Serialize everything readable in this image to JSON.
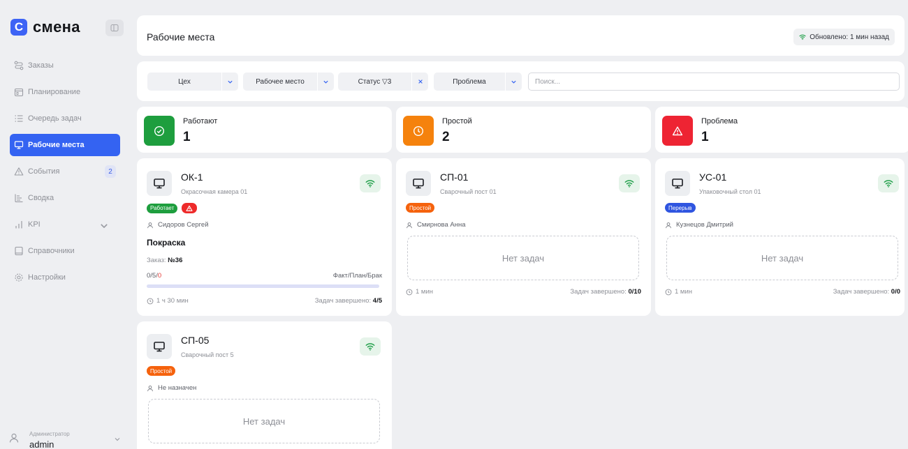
{
  "app": {
    "logo_letter": "C",
    "logo_text": "смена"
  },
  "sidebar": {
    "items": [
      {
        "label": "Заказы",
        "icon": "route-icon"
      },
      {
        "label": "Планирование",
        "icon": "calendar-icon"
      },
      {
        "label": "Очередь задач",
        "icon": "list-icon"
      },
      {
        "label": "Рабочие места",
        "icon": "monitor-icon",
        "active": true
      },
      {
        "label": "События",
        "icon": "warning-icon",
        "badge": "2"
      },
      {
        "label": "Сводка",
        "icon": "chart-icon"
      },
      {
        "label": "KPI",
        "icon": "bars-icon"
      },
      {
        "label": "Справочники",
        "icon": "book-icon"
      },
      {
        "label": "Настройки",
        "icon": "gear-icon"
      }
    ],
    "user": {
      "role": "Администратор",
      "name": "admin"
    }
  },
  "header": {
    "title": "Рабочие места",
    "updated": "Обновлено: 1 мин назад"
  },
  "filters": {
    "shop": "Цех",
    "workplace": "Рабочее место",
    "status": "Статус ▽3",
    "problem": "Проблема",
    "search_placeholder": "Поиск..."
  },
  "stats": [
    {
      "label": "Работают",
      "value": "1",
      "color": "#1e9e3e"
    },
    {
      "label": "Простой",
      "value": "2",
      "color": "#f5820d"
    },
    {
      "label": "Проблема",
      "value": "1",
      "color": "#ee2433"
    }
  ],
  "colors": {
    "accent": "#3463f2",
    "working": "#1e9e3e",
    "idle": "#f5620d",
    "break": "#2f55e0",
    "problem": "#ee2a2a"
  },
  "cards": [
    {
      "name": "ОК-1",
      "desc": "Окрасочная камера 01",
      "status": "Работает",
      "status_color": "#1e9e3e",
      "has_alert": true,
      "operator": "Сидоров Сергей",
      "task": "Покраска",
      "order_label": "Заказ:",
      "order_number": "№36",
      "fact_plan": "0/5/",
      "defect": "0",
      "fpb_label": "Факт/План/Брак",
      "progress": 0,
      "time": "1 ч 30 мин",
      "done_label": "Задач завершено:",
      "done_value": "4/5"
    },
    {
      "name": "СП-01",
      "desc": "Сварочный пост 01",
      "status": "Простой",
      "status_color": "#f5620d",
      "operator": "Смирнова Анна",
      "empty": "Нет задач",
      "time": "1 мин",
      "done_label": "Задач завершено:",
      "done_value": "0/10"
    },
    {
      "name": "УС-01",
      "desc": "Упаковочный стол 01",
      "status": "Перерыв",
      "status_color": "#2f55e0",
      "operator": "Кузнецов Дмитрий",
      "empty": "Нет задач",
      "time": "1 мин",
      "done_label": "Задач завершено:",
      "done_value": "0/0"
    },
    {
      "name": "СП-05",
      "desc": "Сварочный пост 5",
      "status": "Простой",
      "status_color": "#f5620d",
      "operator": "Не назначен",
      "empty": "Нет задач"
    }
  ]
}
